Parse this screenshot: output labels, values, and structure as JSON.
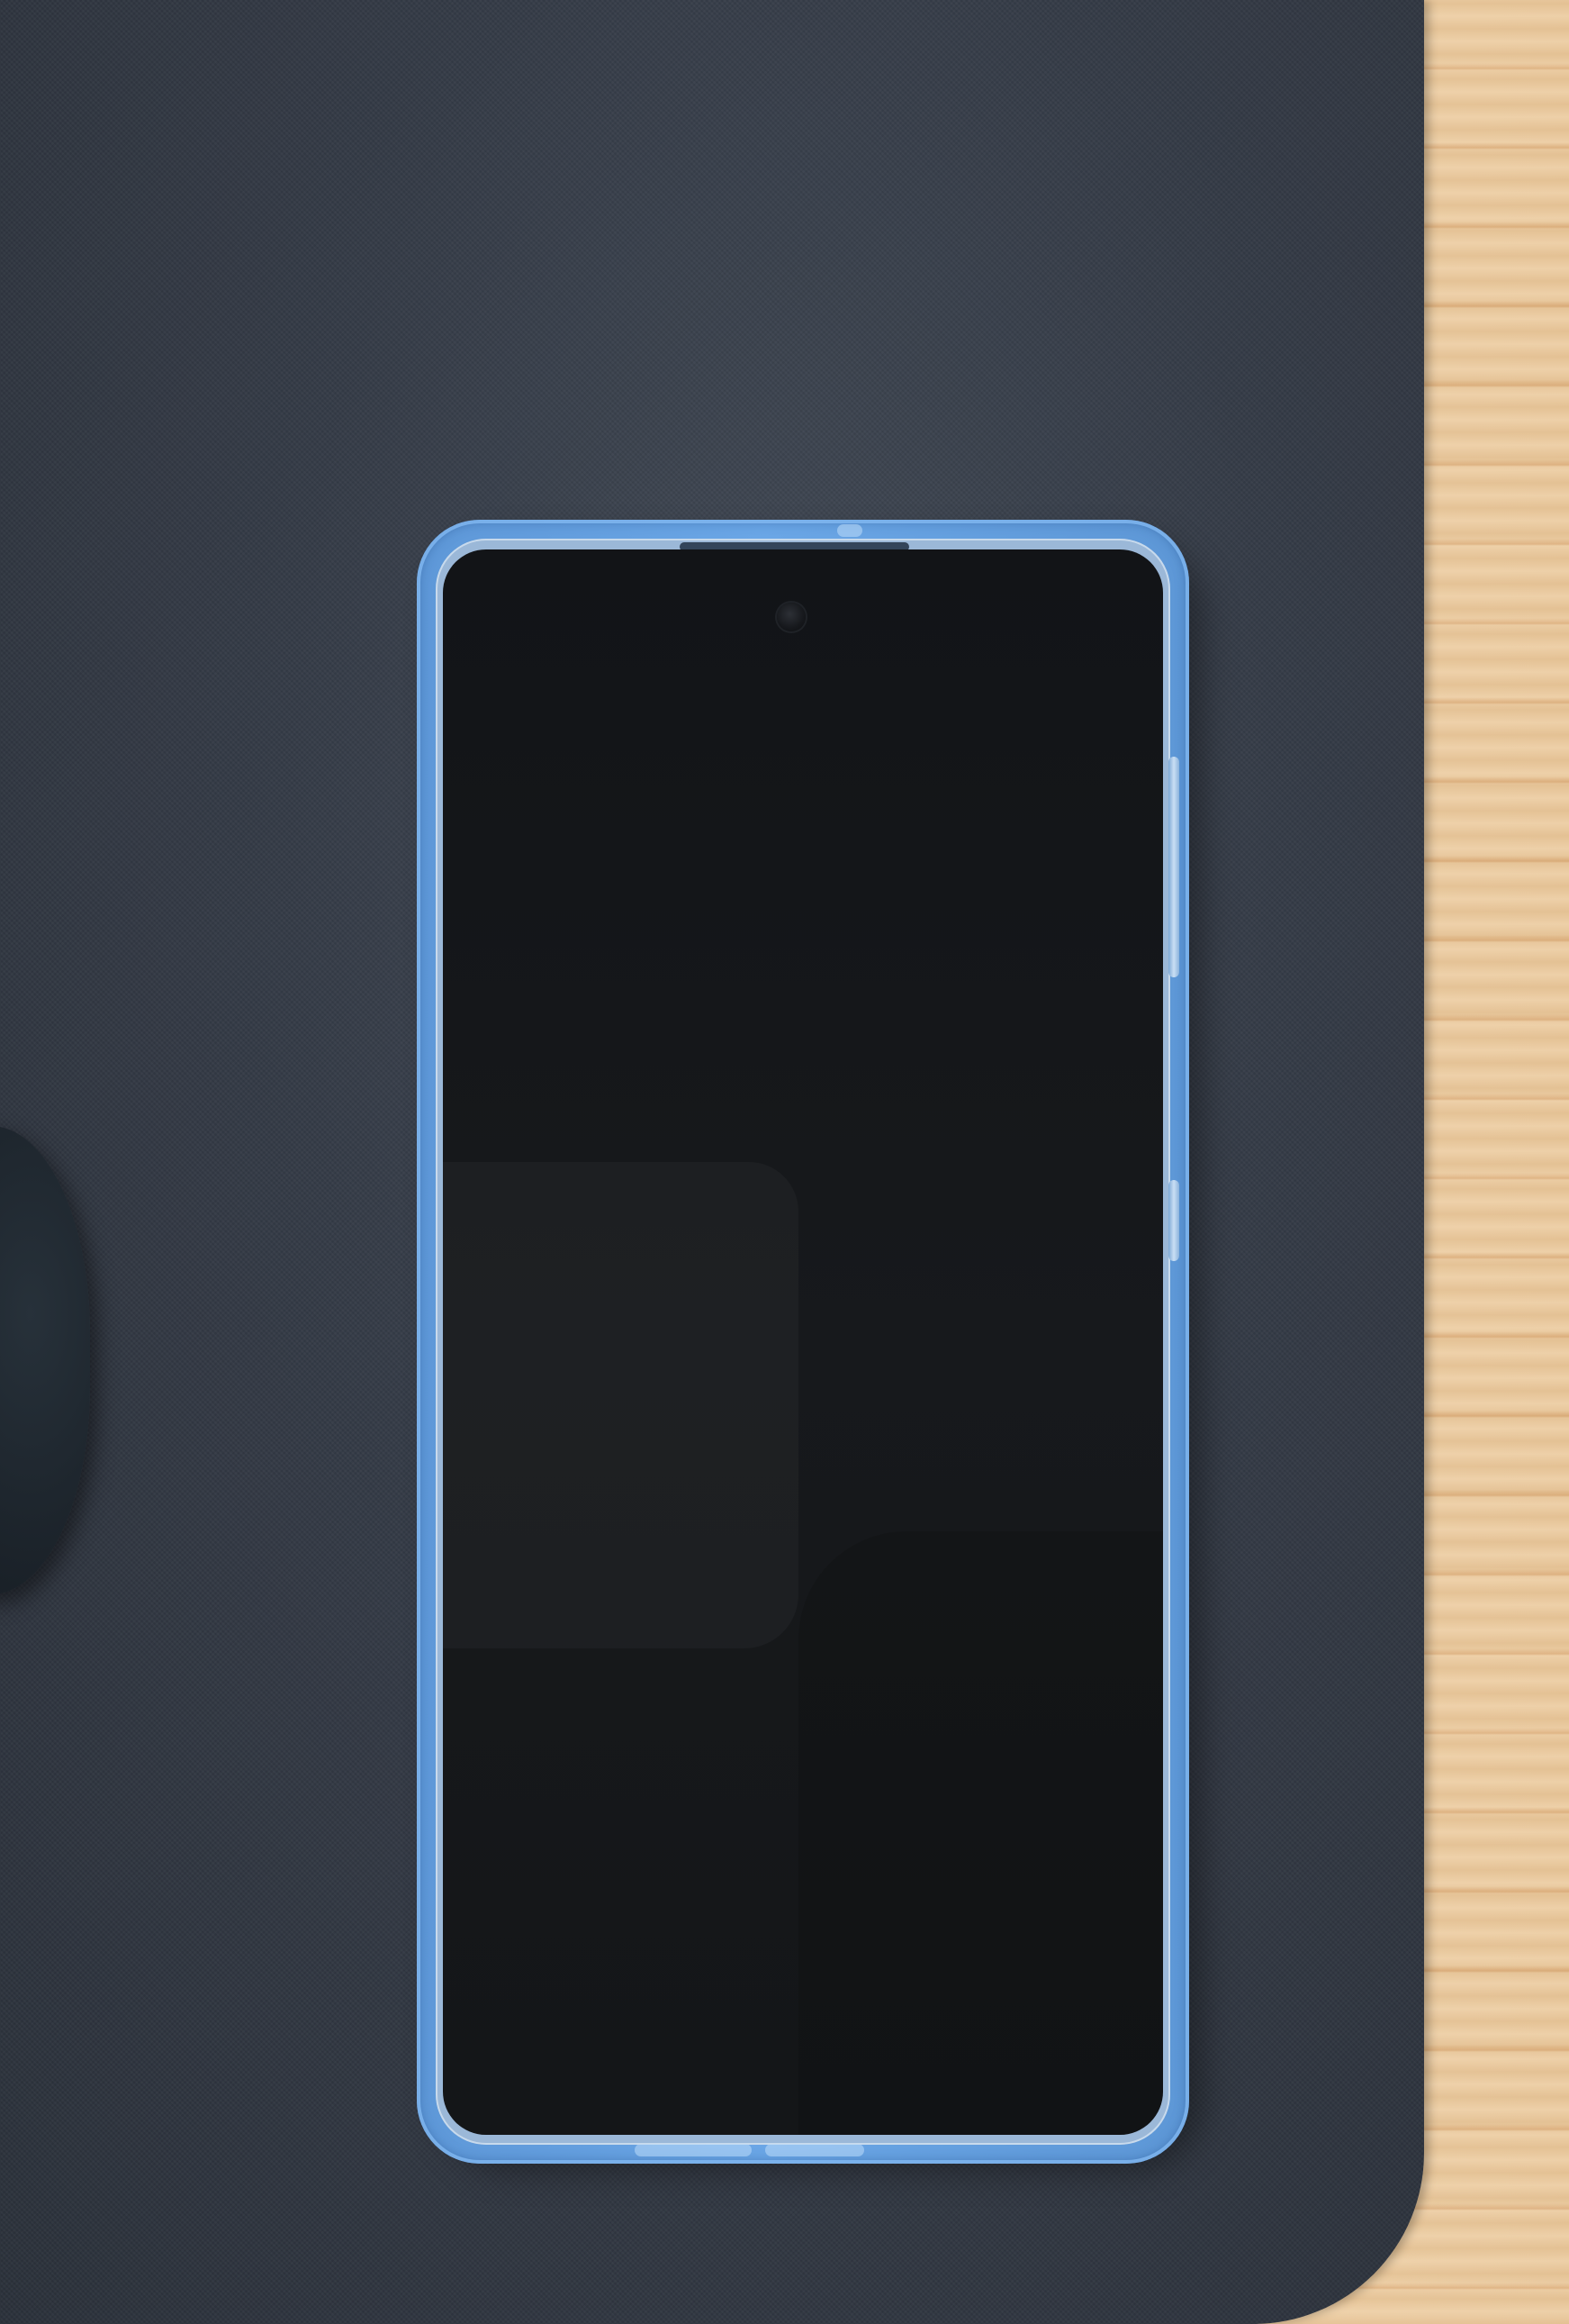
{
  "scene": {
    "description_tags": [
      "phone-on-mousepad"
    ],
    "colors": {
      "desk": "#e6c9a2",
      "mousepad": "#353c47",
      "phone_case": "#6aa6e6",
      "screen": "#141618"
    },
    "phone": {
      "screen_state": "off",
      "icons": [
        "front-camera-icon"
      ]
    }
  }
}
